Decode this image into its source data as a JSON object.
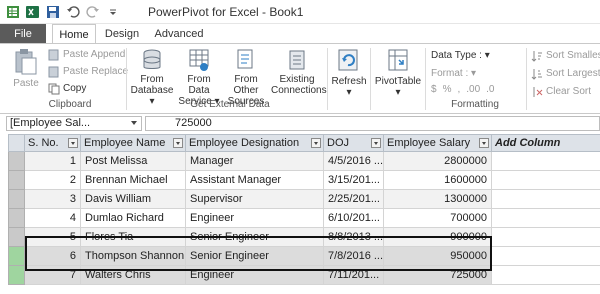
{
  "window": {
    "title": "PowerPivot for Excel - Book1"
  },
  "quick_access": {
    "icons": [
      "table-icon",
      "excel-icon",
      "save-icon",
      "undo-icon",
      "redo-icon",
      "customize-icon"
    ]
  },
  "tabs": [
    {
      "label": "File"
    },
    {
      "label": "Home"
    },
    {
      "label": "Design"
    },
    {
      "label": "Advanced"
    }
  ],
  "ribbon": {
    "clipboard": {
      "group_label": "Clipboard",
      "paste": "Paste",
      "paste_append": "Paste Append",
      "paste_replace": "Paste Replace",
      "copy": "Copy"
    },
    "get_external_data": {
      "group_label": "Get External Data",
      "from_database": [
        "From",
        "Database"
      ],
      "from_data_service": [
        "From Data",
        "Service"
      ],
      "from_other_sources": [
        "From Other",
        "Sources"
      ],
      "existing_connections": [
        "Existing",
        "Connections"
      ]
    },
    "refresh": {
      "label": "Refresh"
    },
    "pivottable": {
      "label": "PivotTable"
    },
    "formatting": {
      "group_label": "Formatting",
      "data_type": "Data Type :",
      "format": "Format :",
      "symbols": [
        "$",
        "%",
        ",",
        ".00",
        ".0"
      ]
    },
    "sort": {
      "smallest": "Sort Smalles",
      "largest": "Sort Largest",
      "clear": "Clear Sort"
    }
  },
  "formula_bar": {
    "name_box": "[Employee Sal...",
    "value": "725000"
  },
  "table": {
    "columns": [
      "S. No.",
      "Employee Name",
      "Employee Designation",
      "DOJ",
      "Employee Salary",
      "Add Column"
    ],
    "rows": [
      [
        "1",
        "Post Melissa",
        "Manager",
        "4/5/2016 ...",
        "2800000"
      ],
      [
        "2",
        "Brennan Michael",
        "Assistant Manager",
        "3/15/201...",
        "1600000"
      ],
      [
        "3",
        "Davis William",
        "Supervisor",
        "2/25/201...",
        "1300000"
      ],
      [
        "4",
        "Dumlao Richard",
        "Engineer",
        "6/10/201...",
        "700000"
      ],
      [
        "5",
        "Flores Tia",
        "Senior Engineer",
        "8/8/2013 ...",
        "900000"
      ],
      [
        "6",
        "Thompson Shannon",
        "Senior Engineer",
        "7/8/2016 ...",
        "950000"
      ],
      [
        "7",
        "Walters Chris",
        "Engineer",
        "7/11/201...",
        "725000"
      ]
    ]
  }
}
